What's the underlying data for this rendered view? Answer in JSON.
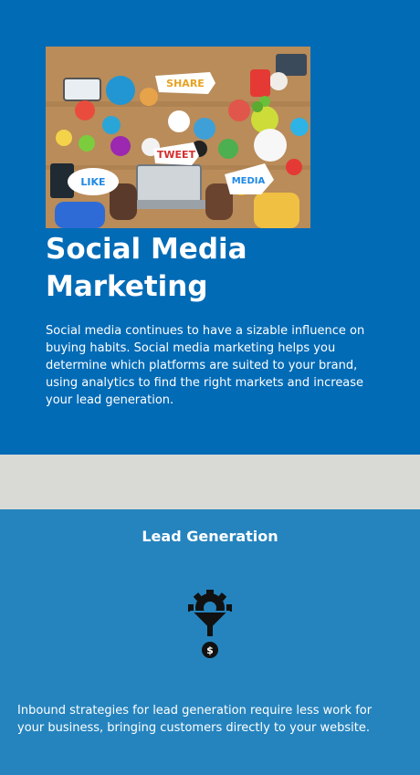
{
  "hero": {
    "image": {
      "bubbles": [
        "SHARE",
        "TWEET",
        "LIKE",
        "MEDIA"
      ]
    },
    "title": "Social Media Marketing",
    "body": "Social media continues to have a sizable influence on buying habits. Social media marketing helps you determine which platforms are suited to your brand, using analytics to find the right markets and increase your lead generation."
  },
  "lead": {
    "title": "Lead Generation",
    "icon": "funnel-gear-dollar-icon",
    "body": "Inbound strategies for lead generation require less work for your business, bringing customers directly to your website."
  },
  "colors": {
    "hero_bg": "#026bb6",
    "divider": "#d9dad6",
    "lead_bg": "#2584be",
    "text": "#ffffff"
  }
}
